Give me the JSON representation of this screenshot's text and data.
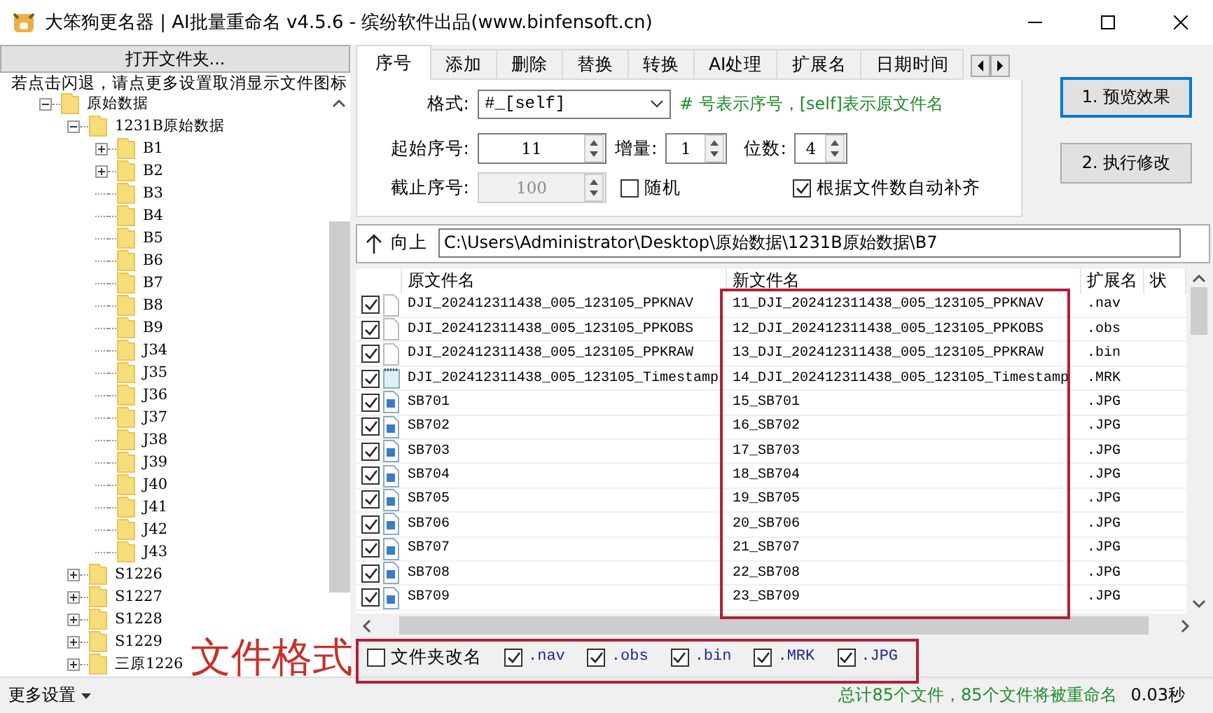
{
  "window": {
    "title": "大笨狗更名器 | AI批量重命名 v4.5.6 - 缤纷软件出品(www.binfensoft.cn)"
  },
  "sidebar": {
    "open_button": "打开文件夹...",
    "hint": "若点击闪退，请点更多设置取消显示文件图标",
    "tree": [
      {
        "label": "原始数据",
        "kind": "expanded",
        "children": [
          {
            "label": "1231B原始数据",
            "kind": "expanded",
            "children": [
              {
                "label": "B1",
                "kind": "collapsed"
              },
              {
                "label": "B2",
                "kind": "collapsed"
              },
              {
                "label": "B3",
                "kind": "leaf"
              },
              {
                "label": "B4",
                "kind": "leaf"
              },
              {
                "label": "B5",
                "kind": "leaf"
              },
              {
                "label": "B6",
                "kind": "leaf"
              },
              {
                "label": "B7",
                "kind": "leaf"
              },
              {
                "label": "B8",
                "kind": "leaf"
              },
              {
                "label": "B9",
                "kind": "leaf"
              },
              {
                "label": "J34",
                "kind": "leaf"
              },
              {
                "label": "J35",
                "kind": "leaf"
              },
              {
                "label": "J36",
                "kind": "leaf"
              },
              {
                "label": "J37",
                "kind": "leaf"
              },
              {
                "label": "J38",
                "kind": "leaf"
              },
              {
                "label": "J39",
                "kind": "leaf"
              },
              {
                "label": "J40",
                "kind": "leaf"
              },
              {
                "label": "J41",
                "kind": "leaf"
              },
              {
                "label": "J42",
                "kind": "leaf"
              },
              {
                "label": "J43",
                "kind": "leaf"
              }
            ]
          },
          {
            "label": "S1226",
            "kind": "collapsed"
          },
          {
            "label": "S1227",
            "kind": "collapsed"
          },
          {
            "label": "S1228",
            "kind": "collapsed"
          },
          {
            "label": "S1229",
            "kind": "collapsed"
          },
          {
            "label": "三原1226",
            "kind": "collapsed"
          }
        ]
      }
    ]
  },
  "tabs": [
    {
      "label": "序号",
      "selected": true
    },
    {
      "label": "添加",
      "selected": false
    },
    {
      "label": "删除",
      "selected": false
    },
    {
      "label": "替换",
      "selected": false
    },
    {
      "label": "转换",
      "selected": false
    },
    {
      "label": "AI处理",
      "selected": false
    },
    {
      "label": "扩展名",
      "selected": false
    },
    {
      "label": "日期时间",
      "selected": false
    }
  ],
  "numbering": {
    "format_label": "格式:",
    "format_value": "#_[self]",
    "format_hint": "# 号表示序号，[self]表示原文件名",
    "start_label": "起始序号:",
    "start_value": "11",
    "step_label": "增量:",
    "step_value": "1",
    "digits_label": "位数:",
    "digits_value": "4",
    "end_label": "截止序号:",
    "end_value": "100",
    "end_disabled": true,
    "random": {
      "label": "随机",
      "checked": false
    },
    "autopad": {
      "label": "根据文件数自动补齐",
      "checked": true
    }
  },
  "actions": [
    {
      "label": "1. 预览效果",
      "focused": true
    },
    {
      "label": "2. 执行修改",
      "focused": false
    }
  ],
  "path_bar": {
    "up_label": "向上",
    "path": "C:\\Users\\Administrator\\Desktop\\原始数据\\1231B原始数据\\B7"
  },
  "table": {
    "columns": [
      "原文件名",
      "新文件名",
      "扩展名",
      "状"
    ],
    "rows": [
      {
        "kind": "data",
        "checked": true,
        "original": "DJI_202412311438_005_123105_PPKNAV",
        "new": "11_DJI_202412311438_005_123105_PPKNAV",
        "ext": ".nav"
      },
      {
        "kind": "data",
        "checked": true,
        "original": "DJI_202412311438_005_123105_PPKOBS",
        "new": "12_DJI_202412311438_005_123105_PPKOBS",
        "ext": ".obs"
      },
      {
        "kind": "data",
        "checked": true,
        "original": "DJI_202412311438_005_123105_PPKRAW",
        "new": "13_DJI_202412311438_005_123105_PPKRAW",
        "ext": ".bin"
      },
      {
        "kind": "text",
        "checked": true,
        "original": "DJI_202412311438_005_123105_Timestamp",
        "new": "14_DJI_202412311438_005_123105_Timestamp",
        "ext": ".MRK"
      },
      {
        "kind": "image",
        "checked": true,
        "original": "SB701",
        "new": "15_SB701",
        "ext": ".JPG"
      },
      {
        "kind": "image",
        "checked": true,
        "original": "SB702",
        "new": "16_SB702",
        "ext": ".JPG"
      },
      {
        "kind": "image",
        "checked": true,
        "original": "SB703",
        "new": "17_SB703",
        "ext": ".JPG"
      },
      {
        "kind": "image",
        "checked": true,
        "original": "SB704",
        "new": "18_SB704",
        "ext": ".JPG"
      },
      {
        "kind": "image",
        "checked": true,
        "original": "SB705",
        "new": "19_SB705",
        "ext": ".JPG"
      },
      {
        "kind": "image",
        "checked": true,
        "original": "SB706",
        "new": "20_SB706",
        "ext": ".JPG"
      },
      {
        "kind": "image",
        "checked": true,
        "original": "SB707",
        "new": "21_SB707",
        "ext": ".JPG"
      },
      {
        "kind": "image",
        "checked": true,
        "original": "SB708",
        "new": "22_SB708",
        "ext": ".JPG"
      },
      {
        "kind": "image",
        "checked": true,
        "original": "SB709",
        "new": "23_SB709",
        "ext": ".JPG"
      }
    ]
  },
  "filters": [
    {
      "label": "文件夹改名",
      "checked": false,
      "kind": "plain"
    },
    {
      "label": ".nav",
      "checked": true,
      "kind": "ext"
    },
    {
      "label": ".obs",
      "checked": true,
      "kind": "ext"
    },
    {
      "label": ".bin",
      "checked": true,
      "kind": "ext"
    },
    {
      "label": ".MRK",
      "checked": true,
      "kind": "ext"
    },
    {
      "label": ".JPG",
      "checked": true,
      "kind": "ext"
    }
  ],
  "annotation": {
    "label": "文件格式"
  },
  "status_bar": {
    "more_settings": "更多设置",
    "summary": "总计85个文件，85个文件将被重命名",
    "time": "0.03秒"
  }
}
